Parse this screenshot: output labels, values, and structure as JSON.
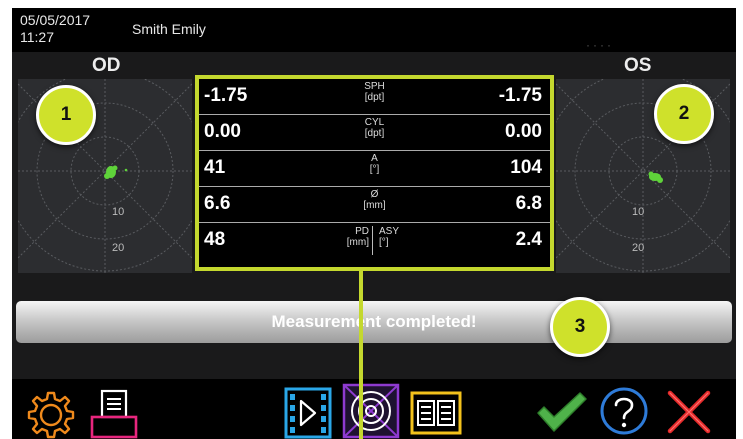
{
  "header": {
    "date": "05/05/2017",
    "time": "11:27",
    "patient": "Smith Emily"
  },
  "eyes": {
    "left_label": "OD",
    "right_label": "OS"
  },
  "plots": {
    "ring_labels": [
      "10",
      "20"
    ]
  },
  "measurements": {
    "rows": [
      {
        "label": "SPH",
        "unit": "[dpt]",
        "od": "-1.75",
        "os": "-1.75"
      },
      {
        "label": "CYL",
        "unit": "[dpt]",
        "od": "0.00",
        "os": "0.00"
      },
      {
        "label": "A",
        "unit": "[°]",
        "od": "41",
        "os": "104"
      },
      {
        "label": "Ø",
        "unit": "[mm]",
        "od": "6.6",
        "os": "6.8"
      }
    ],
    "pd_row": {
      "pd_label": "PD",
      "pd_unit": "[mm]",
      "pd_value": "48",
      "asy_label": "ASY",
      "asy_unit": "[°]",
      "asy_value": "2.4"
    }
  },
  "status": {
    "text": "Measurement completed!"
  },
  "callouts": {
    "c1": "1",
    "c2": "2",
    "c3": "3"
  },
  "toolbar": {
    "icons": [
      "gear-icon",
      "printer-icon",
      "video-icon",
      "target-icon",
      "report-icon",
      "checkmark-icon",
      "help-icon",
      "close-icon"
    ]
  },
  "colors": {
    "highlight": "#c4d82e",
    "callout": "#cfe12b",
    "spot": "#5fd33a"
  }
}
